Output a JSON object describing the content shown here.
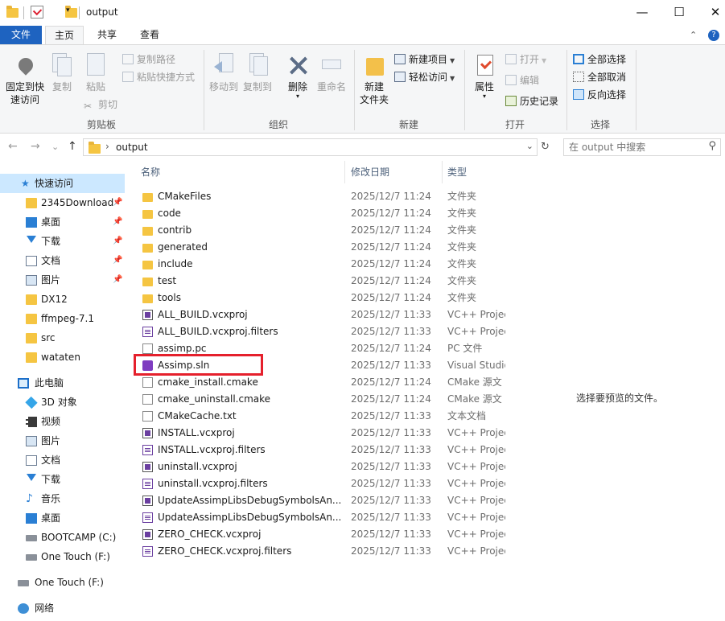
{
  "window": {
    "title": "output",
    "controls": {
      "minimize": "—",
      "maximize": "☐",
      "close": "✕"
    }
  },
  "ribbon_tabs": [
    "文件",
    "主页",
    "共享",
    "查看"
  ],
  "ribbon_controls": {
    "collapse": "⌃",
    "help": "?"
  },
  "ribbon": {
    "clipboard": {
      "label": "剪贴板",
      "pin": "固定到快\n速访问",
      "copy": "复制",
      "paste": "粘贴",
      "copy_path": "复制路径",
      "paste_shortcut": "粘贴快捷方式",
      "cut": "剪切"
    },
    "organize": {
      "label": "组织",
      "move_to": "移动到",
      "copy_to": "复制到",
      "delete": "删除",
      "rename": "重命名"
    },
    "new": {
      "label": "新建",
      "new_folder": "新建\n文件夹",
      "new_item": "新建项目",
      "easy_access": "轻松访问"
    },
    "open": {
      "label": "打开",
      "properties": "属性",
      "open": "打开",
      "edit": "编辑",
      "history": "历史记录"
    },
    "select": {
      "label": "选择",
      "select_all": "全部选择",
      "select_none": "全部取消",
      "invert": "反向选择"
    }
  },
  "address": {
    "back": "←",
    "forward": "→",
    "recent": "⌄",
    "up": "↑",
    "path_sep": "›",
    "path": "output",
    "dropdown": "⌄",
    "refresh": "↻",
    "search_placeholder": "在 output 中搜索",
    "search_icon": "⚲"
  },
  "nav": {
    "quick_access": "快速访问",
    "quick_items": [
      {
        "label": "2345Download",
        "icon": "folder",
        "pinned": true
      },
      {
        "label": "桌面",
        "icon": "desktop",
        "pinned": true
      },
      {
        "label": "下载",
        "icon": "download",
        "pinned": true
      },
      {
        "label": "文档",
        "icon": "document",
        "pinned": true
      },
      {
        "label": "图片",
        "icon": "picture",
        "pinned": true
      },
      {
        "label": "DX12",
        "icon": "folder",
        "pinned": false
      },
      {
        "label": "ffmpeg-7.1",
        "icon": "folder",
        "pinned": false
      },
      {
        "label": "src",
        "icon": "folder",
        "pinned": false
      },
      {
        "label": "wataten",
        "icon": "folder",
        "pinned": false
      }
    ],
    "pin_glyph": "📌",
    "this_pc": "此电脑",
    "pc_items": [
      {
        "label": "3D 对象",
        "icon": "cube"
      },
      {
        "label": "视频",
        "icon": "video"
      },
      {
        "label": "图片",
        "icon": "picture"
      },
      {
        "label": "文档",
        "icon": "document"
      },
      {
        "label": "下载",
        "icon": "download"
      },
      {
        "label": "音乐",
        "icon": "music"
      },
      {
        "label": "桌面",
        "icon": "desktop"
      },
      {
        "label": "BOOTCAMP (C:)",
        "icon": "drive"
      },
      {
        "label": "One Touch (F:)",
        "icon": "drive"
      }
    ],
    "drive_root": "One Touch (F:)",
    "network": "网络"
  },
  "columns": {
    "name": "名称",
    "date": "修改日期",
    "type": "类型",
    "sort_glyph": "^"
  },
  "files": [
    {
      "name": "CMakeFiles",
      "date": "2025/12/7 11:24",
      "type": "文件夹",
      "icon": "folder"
    },
    {
      "name": "code",
      "date": "2025/12/7 11:24",
      "type": "文件夹",
      "icon": "folder"
    },
    {
      "name": "contrib",
      "date": "2025/12/7 11:24",
      "type": "文件夹",
      "icon": "folder"
    },
    {
      "name": "generated",
      "date": "2025/12/7 11:24",
      "type": "文件夹",
      "icon": "folder"
    },
    {
      "name": "include",
      "date": "2025/12/7 11:24",
      "type": "文件夹",
      "icon": "folder"
    },
    {
      "name": "test",
      "date": "2025/12/7 11:24",
      "type": "文件夹",
      "icon": "folder"
    },
    {
      "name": "tools",
      "date": "2025/12/7 11:24",
      "type": "文件夹",
      "icon": "folder"
    },
    {
      "name": "ALL_BUILD.vcxproj",
      "date": "2025/12/7 11:33",
      "type": "VC++ Projec",
      "icon": "vcxproj"
    },
    {
      "name": "ALL_BUILD.vcxproj.filters",
      "date": "2025/12/7 11:33",
      "type": "VC++ Projec",
      "icon": "filters"
    },
    {
      "name": "assimp.pc",
      "date": "2025/12/7 11:24",
      "type": "PC 文件",
      "icon": "text"
    },
    {
      "name": "Assimp.sln",
      "date": "2025/12/7 11:33",
      "type": "Visual Studio",
      "icon": "sln"
    },
    {
      "name": "cmake_install.cmake",
      "date": "2025/12/7 11:24",
      "type": "CMake 源文",
      "icon": "text"
    },
    {
      "name": "cmake_uninstall.cmake",
      "date": "2025/12/7 11:24",
      "type": "CMake 源文",
      "icon": "text"
    },
    {
      "name": "CMakeCache.txt",
      "date": "2025/12/7 11:33",
      "type": "文本文档",
      "icon": "text"
    },
    {
      "name": "INSTALL.vcxproj",
      "date": "2025/12/7 11:33",
      "type": "VC++ Projec",
      "icon": "vcxproj"
    },
    {
      "name": "INSTALL.vcxproj.filters",
      "date": "2025/12/7 11:33",
      "type": "VC++ Projec",
      "icon": "filters"
    },
    {
      "name": "uninstall.vcxproj",
      "date": "2025/12/7 11:33",
      "type": "VC++ Projec",
      "icon": "vcxproj"
    },
    {
      "name": "uninstall.vcxproj.filters",
      "date": "2025/12/7 11:33",
      "type": "VC++ Projec",
      "icon": "filters"
    },
    {
      "name": "UpdateAssimpLibsDebugSymbolsAn...",
      "date": "2025/12/7 11:33",
      "type": "VC++ Projec",
      "icon": "vcxproj"
    },
    {
      "name": "UpdateAssimpLibsDebugSymbolsAn...",
      "date": "2025/12/7 11:33",
      "type": "VC++ Projec",
      "icon": "filters"
    },
    {
      "name": "ZERO_CHECK.vcxproj",
      "date": "2025/12/7 11:33",
      "type": "VC++ Projec",
      "icon": "vcxproj"
    },
    {
      "name": "ZERO_CHECK.vcxproj.filters",
      "date": "2025/12/7 11:33",
      "type": "VC++ Projec",
      "icon": "filters"
    }
  ],
  "highlighted_file": "Assimp.sln",
  "highlight_color": "#e5202c",
  "accent_color": "#1e63c0",
  "preview": {
    "message": "选择要预览的文件。"
  }
}
